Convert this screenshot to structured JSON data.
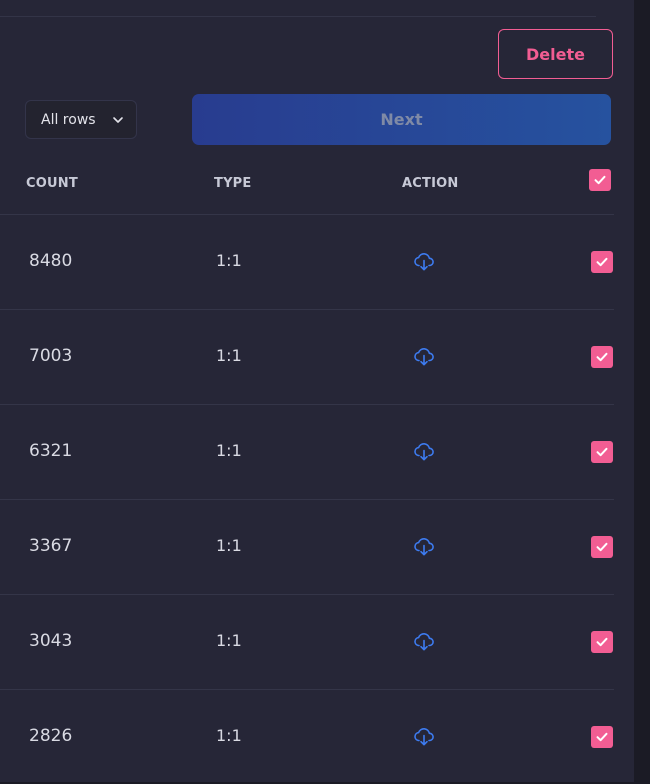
{
  "toolbar": {
    "delete_label": "Delete",
    "rows_filter": "All rows",
    "next_label": "Next"
  },
  "table": {
    "headers": {
      "count": "COUNT",
      "type": "TYPE",
      "action": "ACTION"
    },
    "select_all_checked": true,
    "rows": [
      {
        "count": "8480",
        "type": "1:1",
        "action_icon": "cloud-download-icon",
        "checked": true
      },
      {
        "count": "7003",
        "type": "1:1",
        "action_icon": "cloud-download-icon",
        "checked": true
      },
      {
        "count": "6321",
        "type": "1:1",
        "action_icon": "cloud-download-icon",
        "checked": true
      },
      {
        "count": "3367",
        "type": "1:1",
        "action_icon": "cloud-download-icon",
        "checked": true
      },
      {
        "count": "3043",
        "type": "1:1",
        "action_icon": "cloud-download-icon",
        "checked": true
      },
      {
        "count": "2826",
        "type": "1:1",
        "action_icon": "cloud-download-icon",
        "checked": true
      }
    ]
  },
  "colors": {
    "background": "#262637",
    "accent_pink": "#f25d93",
    "next_gradient_start": "#283c8f",
    "next_gradient_end": "#26529f",
    "icon_blue": "#3d7bf0"
  }
}
